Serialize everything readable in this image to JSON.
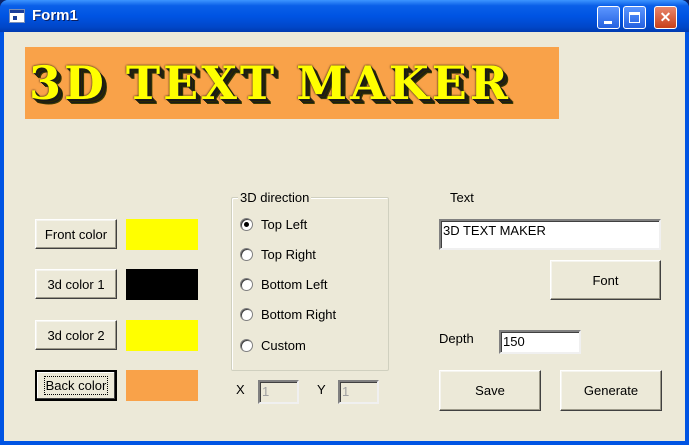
{
  "window": {
    "title": "Form1"
  },
  "banner": {
    "text": "3D TEXT MAKER",
    "background": "#f9a249",
    "front_color": "#ffff00",
    "depth_color": "#1a1a1a"
  },
  "buttons": {
    "front_color": "Front color",
    "color3d_1": "3d color 1",
    "color3d_2": "3d color 2",
    "back_color": "Back color",
    "font": "Font",
    "save": "Save",
    "generate": "Generate"
  },
  "swatches": {
    "front": "#ffff00",
    "color3d_1": "#000000",
    "color3d_2": "#ffff00",
    "back": "#f9a249"
  },
  "direction": {
    "label": "3D direction",
    "options": [
      "Top Left",
      "Top Right",
      "Bottom Left",
      "Bottom Right",
      "Custom"
    ],
    "selected": "Top Left"
  },
  "custom": {
    "x_label": "X",
    "x_value": "1",
    "y_label": "Y",
    "y_value": "1"
  },
  "text": {
    "label": "Text",
    "value": "3D TEXT MAKER"
  },
  "depth": {
    "label": "Depth",
    "value": "150"
  }
}
